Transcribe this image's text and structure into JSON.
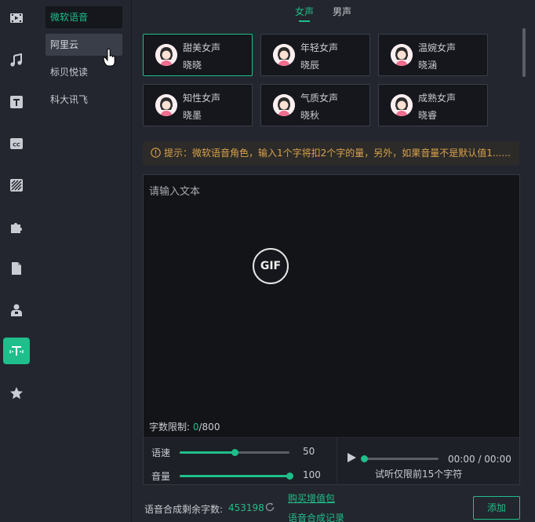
{
  "rail": {
    "icons": [
      "video-icon",
      "music-icon",
      "text-icon",
      "caption-icon",
      "sticker-icon",
      "plugin-icon",
      "folder-icon",
      "person-icon",
      "tts-icon",
      "star-icon"
    ],
    "active": "tts-icon",
    "accent": "#1fbe8a"
  },
  "providers": {
    "items": [
      {
        "label": "微软语音",
        "state": "selected"
      },
      {
        "label": "阿里云",
        "state": "hover"
      },
      {
        "label": "标贝悦读",
        "state": "normal"
      },
      {
        "label": "科大讯飞",
        "state": "normal"
      }
    ]
  },
  "tabs": {
    "female": "女声",
    "male": "男声",
    "active": "female"
  },
  "voices": [
    {
      "type": "甜美女声",
      "name": "晓晓",
      "selected": true
    },
    {
      "type": "年轻女声",
      "name": "晓辰",
      "selected": false
    },
    {
      "type": "温婉女声",
      "name": "晓涵",
      "selected": false
    },
    {
      "type": "知性女声",
      "name": "晓墨",
      "selected": false
    },
    {
      "type": "气质女声",
      "name": "晓秋",
      "selected": false
    },
    {
      "type": "成熟女声",
      "name": "晓睿",
      "selected": false
    }
  ],
  "notice": {
    "icon": "info-icon",
    "text": "提示：微软语音角色，输入1个字将扣2个字的量，另外，如果音量不是默认值1......"
  },
  "editor": {
    "placeholder": "请输入文本",
    "gif_label": "GIF",
    "count_label": "字数限制: ",
    "count_current": "0",
    "count_max": "/800"
  },
  "controls": {
    "speed": {
      "label": "语速",
      "value": "50",
      "fraction": 0.5
    },
    "volume": {
      "label": "音量",
      "value": "100",
      "fraction": 1.0
    }
  },
  "player": {
    "time": "00:00 / 00:00",
    "tip": "试听仅限前15个字符",
    "progress": 0
  },
  "footer": {
    "remaining_label": "语音合成剩余字数:",
    "remaining_value": "453198",
    "buy_link": "购买增值包",
    "history_link": "语音合成记录",
    "add_button": "添加"
  }
}
